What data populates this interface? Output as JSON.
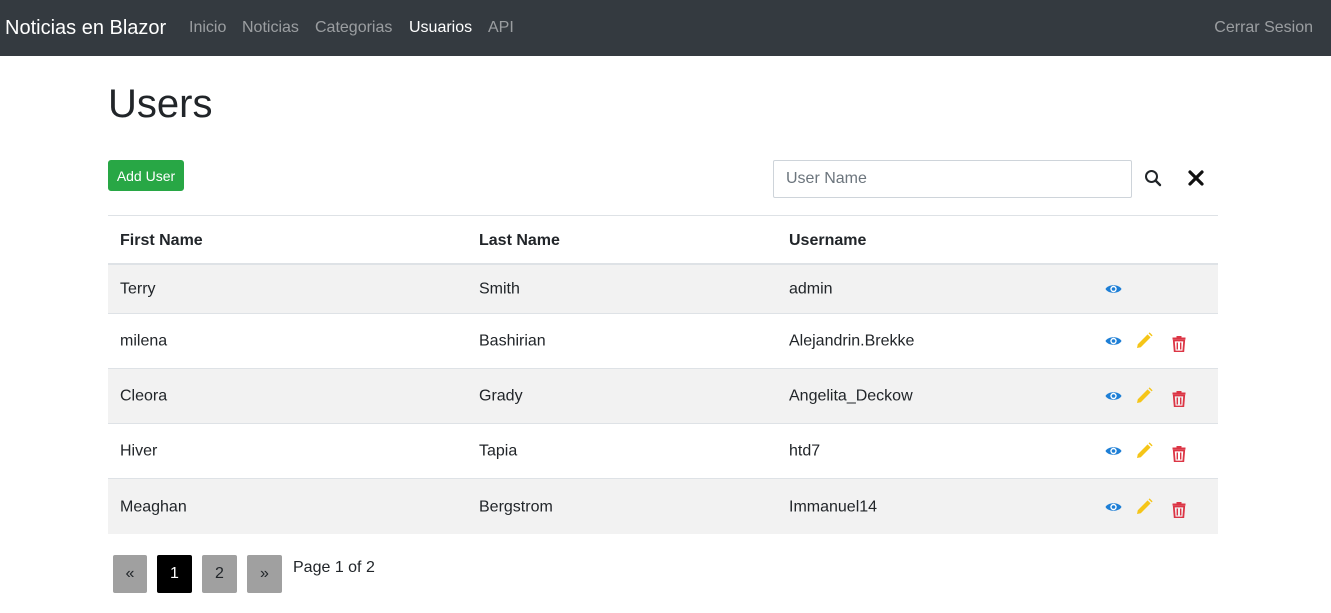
{
  "navbar": {
    "brand": "Noticias en Blazor",
    "links": [
      {
        "label": "Inicio",
        "active": false
      },
      {
        "label": "Noticias",
        "active": false
      },
      {
        "label": "Categorias",
        "active": false
      },
      {
        "label": "Usuarios",
        "active": true
      },
      {
        "label": "API",
        "active": false
      }
    ],
    "logout_label": "Cerrar Sesion"
  },
  "page": {
    "title": "Users",
    "add_button_label": "Add User"
  },
  "search": {
    "placeholder": "User Name",
    "value": "",
    "search_icon": "search-icon",
    "clear_icon": "close-icon"
  },
  "table": {
    "headers": {
      "first_name": "First Name",
      "last_name": "Last Name",
      "username": "Username"
    },
    "rows": [
      {
        "first_name": "Terry",
        "last_name": "Smith",
        "username": "admin",
        "actions": [
          "view"
        ]
      },
      {
        "first_name": "milena",
        "last_name": "Bashirian",
        "username": "Alejandrin.Brekke",
        "actions": [
          "view",
          "edit",
          "delete"
        ]
      },
      {
        "first_name": "Cleora",
        "last_name": "Grady",
        "username": "Angelita_Deckow",
        "actions": [
          "view",
          "edit",
          "delete"
        ]
      },
      {
        "first_name": "Hiver",
        "last_name": "Tapia",
        "username": "htd7",
        "actions": [
          "view",
          "edit",
          "delete"
        ]
      },
      {
        "first_name": "Meaghan",
        "last_name": "Bergstrom",
        "username": "Immanuel14",
        "actions": [
          "view",
          "edit",
          "delete"
        ]
      }
    ]
  },
  "pagination": {
    "prev_label": "«",
    "next_label": "»",
    "pages": [
      "1",
      "2"
    ],
    "current_page": "1",
    "info": "Page 1 of 2"
  },
  "colors": {
    "navbar_bg": "#343a40",
    "add_button": "#28a745",
    "view_icon": "#1e7fd6",
    "edit_icon": "#f5c518",
    "delete_icon": "#dc3545",
    "row_stripe": "#f2f2f2"
  }
}
